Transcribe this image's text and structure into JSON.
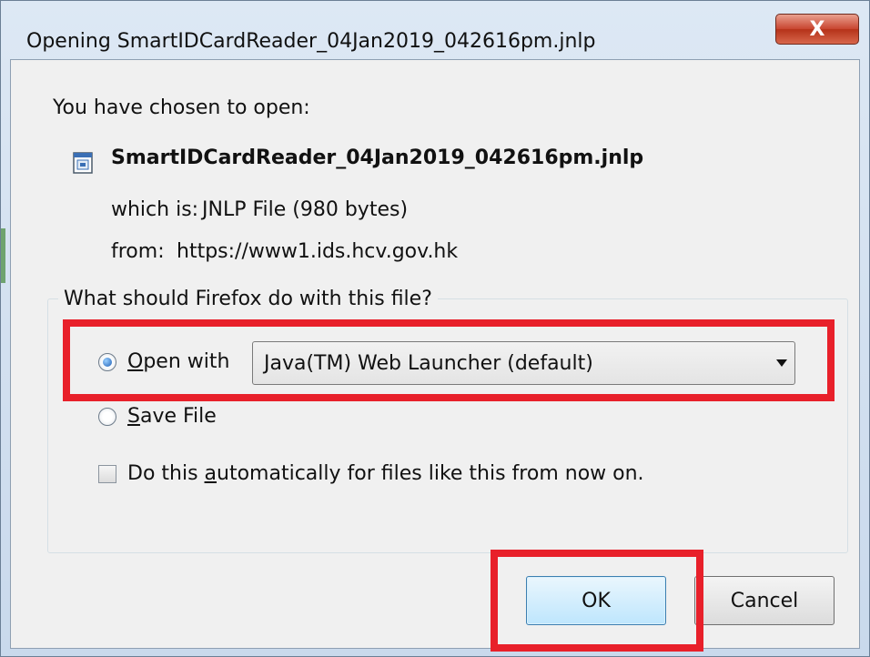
{
  "window": {
    "title": "Opening SmartIDCardReader_04Jan2019_042616pm.jnlp",
    "close_glyph": "X"
  },
  "dialog": {
    "intro": "You have chosen to open:",
    "file_name": "SmartIDCardReader_04Jan2019_042616pm.jnlp",
    "file_icon": "jnlp-file-icon",
    "which_is_label": "which is:",
    "which_is_value": "JNLP File (980 bytes)",
    "from_label": "from:",
    "from_value": "https://www1.ids.hcv.gov.hk"
  },
  "action_group": {
    "legend": "What should Firefox do with this file?",
    "open_with": {
      "label_access": "O",
      "label_rest": "pen with",
      "checked": true
    },
    "application_select": {
      "value": "Java(TM) Web Launcher (default)"
    },
    "save_file": {
      "label_access": "S",
      "label_rest": "ave File",
      "checked": false
    },
    "auto_checkbox": {
      "label_pre": "Do this ",
      "label_access": "a",
      "label_post": "utomatically for files like this from now on.",
      "checked": false
    }
  },
  "buttons": {
    "ok_label": "OK",
    "cancel_label": "Cancel"
  },
  "colors": {
    "highlight": "#e8202a",
    "default_button": "#bee6fd"
  }
}
